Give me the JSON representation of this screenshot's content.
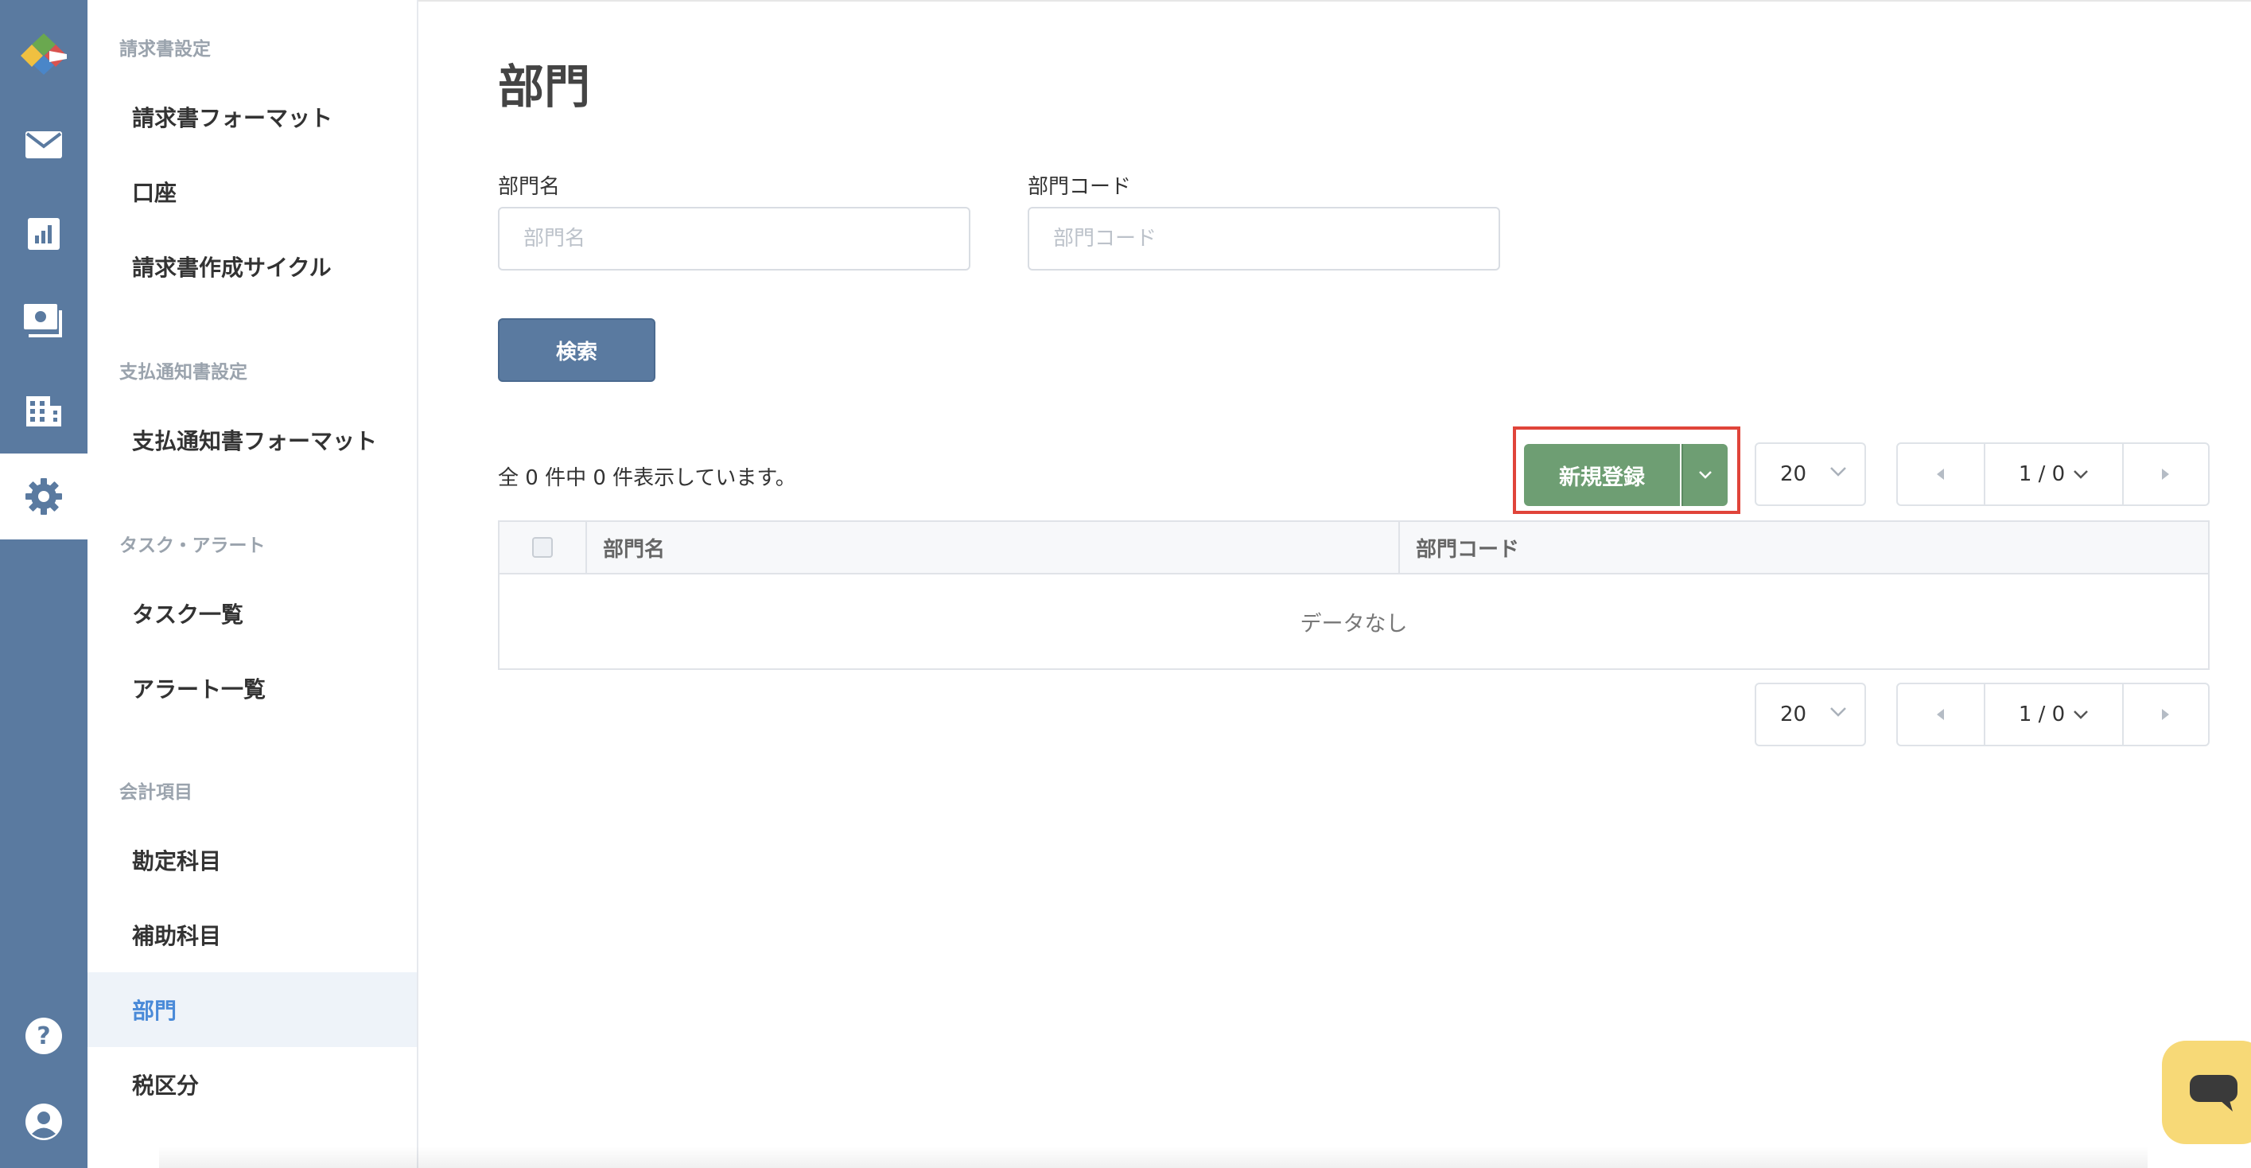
{
  "rail": {
    "items": [
      {
        "icon": "logo-icon"
      },
      {
        "icon": "mail-icon"
      },
      {
        "icon": "chart-icon"
      },
      {
        "icon": "payment-icon"
      },
      {
        "icon": "building-icon"
      },
      {
        "icon": "gear-icon",
        "active": true
      },
      {
        "icon": "help-icon"
      },
      {
        "icon": "user-icon"
      }
    ]
  },
  "sidebar": {
    "sections": [
      {
        "title": "請求書設定",
        "items": [
          "請求書フォーマット",
          "口座",
          "請求書作成サイクル"
        ]
      },
      {
        "title": "支払通知書設定",
        "items": [
          "支払通知書フォーマット"
        ]
      },
      {
        "title": "タスク・アラート",
        "items": [
          "タスク一覧",
          "アラート一覧"
        ]
      },
      {
        "title": "会計項目",
        "items": [
          "勘定科目",
          "補助科目",
          "部門",
          "税区分"
        ]
      }
    ],
    "active_item": "部門"
  },
  "main": {
    "title": "部門",
    "filters": {
      "name_label": "部門名",
      "name_placeholder": "部門名",
      "name_value": "",
      "code_label": "部門コード",
      "code_placeholder": "部門コード",
      "code_value": ""
    },
    "search_label": "検索",
    "count_text": "全 0 件中 0 件表示しています。",
    "new_button_label": "新規登録",
    "per_page": "20",
    "pagination": "1 / 0",
    "table": {
      "columns": [
        "部門名",
        "部門コード"
      ],
      "empty_text": "データなし"
    }
  },
  "colors": {
    "rail": "#5a7aa0",
    "primary_button": "#5a7aa0",
    "new_button": "#6e9e73",
    "highlight": "#e0443a",
    "active_nav_text": "#4a8ad8",
    "chat": "#f7d977"
  }
}
